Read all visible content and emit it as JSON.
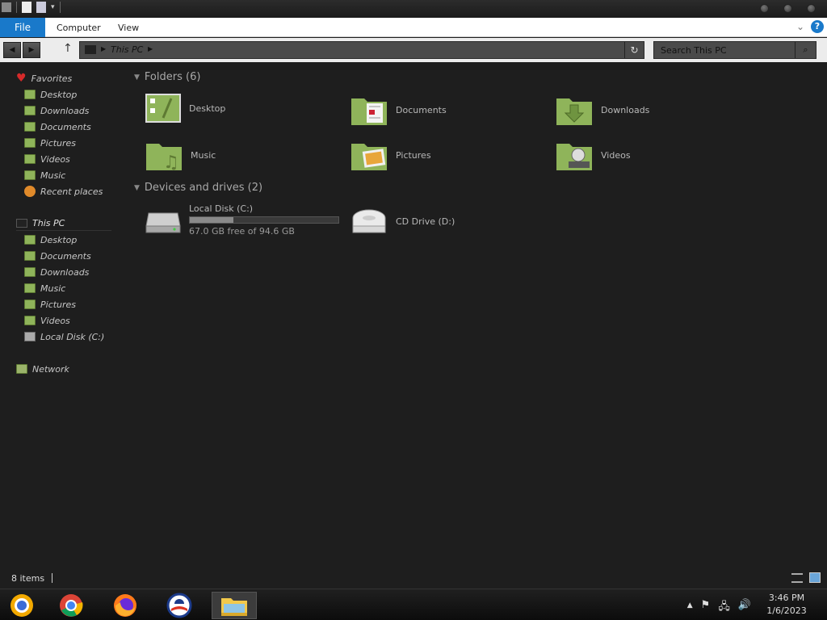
{
  "window": {
    "ribbon_tabs": {
      "file": "File",
      "computer": "Computer",
      "view": "View"
    },
    "help": "?"
  },
  "navigation": {
    "address_crumb": "This PC",
    "search_placeholder": "Search This PC"
  },
  "sidebar": {
    "favorites_label": "Favorites",
    "favorites": [
      {
        "label": "Desktop",
        "icon": "desktop-icon"
      },
      {
        "label": "Downloads",
        "icon": "downloads-folder-icon"
      },
      {
        "label": "Documents",
        "icon": "documents-folder-icon"
      },
      {
        "label": "Pictures",
        "icon": "pictures-folder-icon"
      },
      {
        "label": "Videos",
        "icon": "videos-folder-icon"
      },
      {
        "label": "Music",
        "icon": "music-folder-icon"
      },
      {
        "label": "Recent places",
        "icon": "recent-places-icon"
      }
    ],
    "this_pc_label": "This PC",
    "this_pc": [
      {
        "label": "Desktop",
        "icon": "desktop-icon"
      },
      {
        "label": "Documents",
        "icon": "documents-folder-icon"
      },
      {
        "label": "Downloads",
        "icon": "downloads-folder-icon"
      },
      {
        "label": "Music",
        "icon": "music-folder-icon"
      },
      {
        "label": "Pictures",
        "icon": "pictures-folder-icon"
      },
      {
        "label": "Videos",
        "icon": "videos-folder-icon"
      },
      {
        "label": "Local Disk (C:)",
        "icon": "drive-icon"
      }
    ],
    "network_label": "Network"
  },
  "content": {
    "folders_header": "Folders (6)",
    "folders": [
      {
        "label": "Desktop",
        "icon": "desktop-icon"
      },
      {
        "label": "Documents",
        "icon": "documents-folder-icon"
      },
      {
        "label": "Downloads",
        "icon": "downloads-folder-icon"
      },
      {
        "label": "Music",
        "icon": "music-folder-icon"
      },
      {
        "label": "Pictures",
        "icon": "pictures-folder-icon"
      },
      {
        "label": "Videos",
        "icon": "videos-folder-icon"
      }
    ],
    "devices_header": "Devices and drives (2)",
    "drives": [
      {
        "label": "Local Disk (C:)",
        "free_text": "67.0 GB free of 94.6 GB",
        "used_fraction": 0.292
      },
      {
        "label": "CD Drive (D:)"
      }
    ]
  },
  "status": {
    "items_count": "8 items"
  },
  "taskbar": {
    "apps": [
      "chrome-canary-icon",
      "chrome-icon",
      "firefox-icon",
      "obama-logo-icon",
      "file-explorer-icon"
    ],
    "time": "3:46 PM",
    "date": "1/6/2023"
  },
  "colors": {
    "accent": "#1979ca",
    "folder_green": "#8fb45a",
    "background": "#1e1e1e"
  }
}
